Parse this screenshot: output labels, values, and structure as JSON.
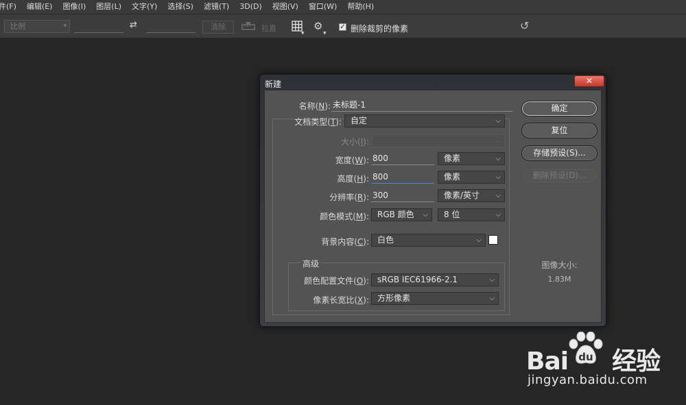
{
  "menubar": {
    "items": [
      "件(F)",
      "编辑(E)",
      "图像(I)",
      "图层(L)",
      "文字(Y)",
      "选择(S)",
      "滤镜(T)",
      "3D(D)",
      "视图(V)",
      "窗口(W)",
      "帮助(H)"
    ]
  },
  "options_bar": {
    "ratio_value": "比例",
    "clear_label": "清除",
    "straighten_label": "拉直",
    "delete_cropped_label": "删除裁剪的像素",
    "delete_cropped_checked": true
  },
  "dialog": {
    "title": "新建",
    "close_symbol": "✕",
    "name_label_pre": "名称(",
    "name_label_key": "N",
    "name_label_post": "):",
    "name_value": "未标题-1",
    "doc_type_label_pre": "文档类型(",
    "doc_type_label_key": "T",
    "doc_type_label_post": "):",
    "doc_type_value": "自定",
    "size_label_pre": "大小(",
    "size_label_key": "I",
    "size_label_post": "):",
    "width_label_pre": "宽度(",
    "width_label_key": "W",
    "width_label_post": "):",
    "width_value": "800",
    "width_unit": "像素",
    "height_label_pre": "高度(",
    "height_label_key": "H",
    "height_label_post": "):",
    "height_value": "800",
    "height_unit": "像素",
    "resolution_label_pre": "分辨率(",
    "resolution_label_key": "R",
    "resolution_label_post": "):",
    "resolution_value": "300",
    "resolution_unit": "像素/英寸",
    "color_mode_label_pre": "颜色模式(",
    "color_mode_label_key": "M",
    "color_mode_label_post": "):",
    "color_mode_value": "RGB 颜色",
    "bit_depth_value": "8 位",
    "bg_label_pre": "背景内容(",
    "bg_label_key": "C",
    "bg_label_post": "):",
    "bg_value": "白色",
    "bg_swatch_color": "#ffffff",
    "advanced_label": "高级",
    "profile_label_pre": "颜色配置文件(",
    "profile_label_key": "O",
    "profile_label_post": "):",
    "profile_value": "sRGB IEC61966-2.1",
    "aspect_label_pre": "像素长宽比(",
    "aspect_label_key": "X",
    "aspect_label_post": "):",
    "aspect_value": "方形像素",
    "buttons": {
      "ok": "确定",
      "reset": "复位",
      "save_preset": "存储预设(S)...",
      "delete_preset": "删除预设(D)..."
    },
    "image_size_label": "图像大小:",
    "image_size_value": "1.83M"
  },
  "watermark": {
    "logo_text": "Bai",
    "logo_suffix": "经验",
    "url": "jingyan.baidu.com"
  }
}
